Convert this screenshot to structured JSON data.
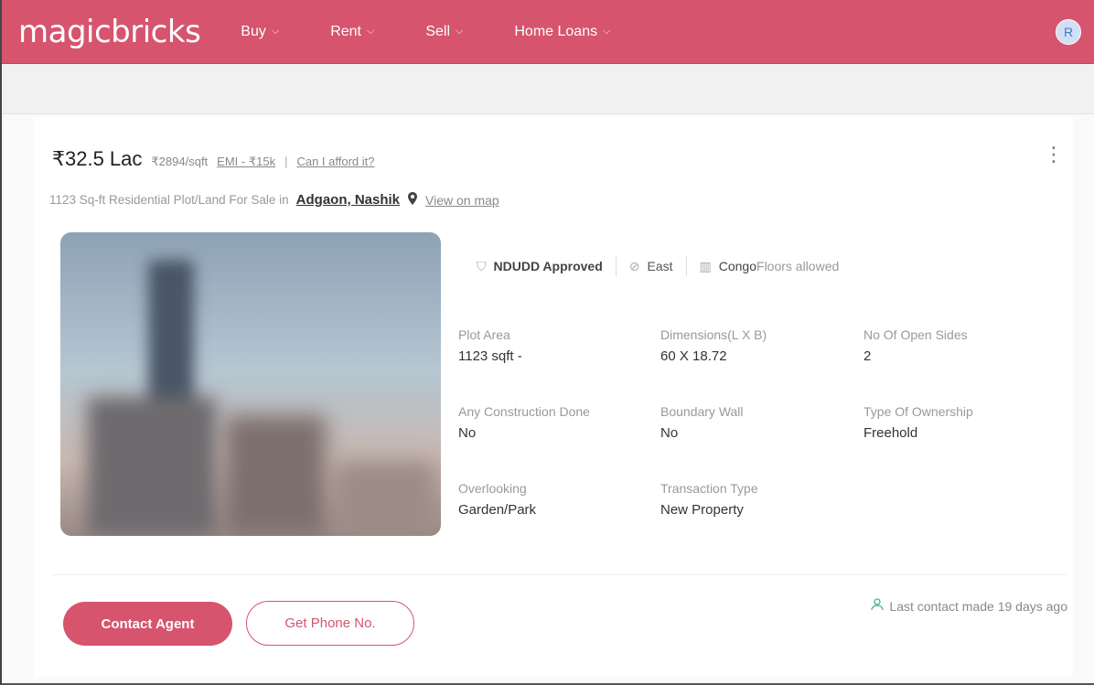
{
  "header": {
    "logo": "magicbricks",
    "nav": [
      {
        "label": "Buy"
      },
      {
        "label": "Rent"
      },
      {
        "label": "Sell"
      },
      {
        "label": "Home Loans"
      }
    ],
    "avatar_initial": "R"
  },
  "listing": {
    "price": "₹32.5 Lac",
    "price_per_sqft": "₹2894/sqft",
    "emi_link": "EMI - ₹15k",
    "separator": "|",
    "afford_link": "Can I afford it?",
    "subtitle": "1123 Sq-ft Residential Plot/Land For Sale in",
    "locality": "Adgaon, Nashik",
    "map_link": "View on map",
    "tags": [
      {
        "icon": "shield-icon",
        "label": "NDUDD Approved"
      },
      {
        "icon": "compass-icon",
        "label": "East"
      },
      {
        "icon": "building-icon",
        "label": "Congo",
        "suffix": "Floors allowed"
      }
    ],
    "details": [
      {
        "label": "Plot Area",
        "value": "1123 sqft -"
      },
      {
        "label": "Dimensions(L X B)",
        "value": "60 X 18.72"
      },
      {
        "label": "No Of Open Sides",
        "value": "2"
      },
      {
        "label": "Any Construction Done",
        "value": "No"
      },
      {
        "label": "Boundary Wall",
        "value": "No"
      },
      {
        "label": "Type Of Ownership",
        "value": "Freehold"
      },
      {
        "label": "Overlooking",
        "value": "Garden/Park"
      },
      {
        "label": "Transaction Type",
        "value": "New Property"
      }
    ],
    "contact_button": "Contact Agent",
    "phone_button": "Get Phone No.",
    "last_contact": "Last contact made 19 days ago"
  },
  "colors": {
    "brand": "#d6546e",
    "accent_green": "#4bb28a"
  }
}
